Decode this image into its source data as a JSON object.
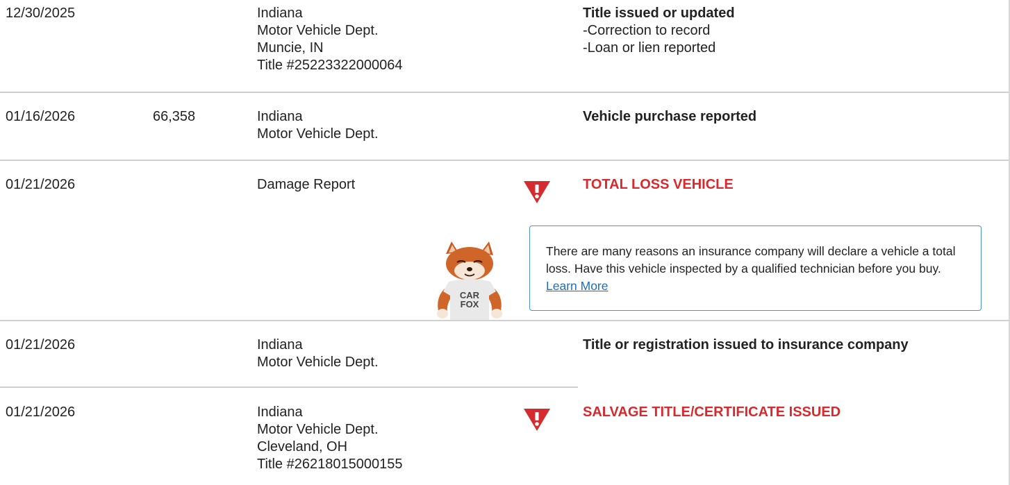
{
  "records": [
    {
      "date": "12/30/2025",
      "odometer": "",
      "source": [
        "Indiana",
        "Motor Vehicle Dept.",
        "Muncie, IN",
        "Title #25223322000064"
      ],
      "detail_title": "Title issued or updated",
      "detail_items": [
        "Correction to record",
        "Loan or lien reported"
      ]
    },
    {
      "date": "01/16/2026",
      "odometer": "66,358",
      "source": [
        "Indiana",
        "Motor Vehicle Dept."
      ],
      "detail_title": "Vehicle purchase reported"
    },
    {
      "date": "01/21/2026",
      "odometer": "",
      "source": [
        "Damage Report"
      ],
      "detail_title": "TOTAL LOSS VEHICLE",
      "alert": true
    },
    {
      "date": "01/21/2026",
      "odometer": "",
      "source": [
        "Indiana",
        "Motor Vehicle Dept."
      ],
      "detail_title": "Title or registration issued to insurance company"
    },
    {
      "date": "01/21/2026",
      "odometer": "",
      "source": [
        "Indiana",
        "Motor Vehicle Dept.",
        "Cleveland, OH",
        "Title #26218015000155"
      ],
      "detail_title": "SALVAGE TITLE/CERTIFICATE ISSUED",
      "alert": true
    }
  ],
  "info_box": {
    "text": "There are many reasons an insurance company will declare a vehicle a total loss. Have this vehicle inspected by a qualified technician before you buy.",
    "link_label": "Learn More"
  },
  "mascot": {
    "shirt_line1": "CAR",
    "shirt_line2": "FOX"
  },
  "colors": {
    "alert": "#d52b2e",
    "link": "#1a6fc4",
    "info_border": "#4a90d6",
    "divider": "#d0d0d0"
  },
  "icons": {
    "alert": "alert-triangle-icon",
    "mascot": "carfox-mascot"
  }
}
